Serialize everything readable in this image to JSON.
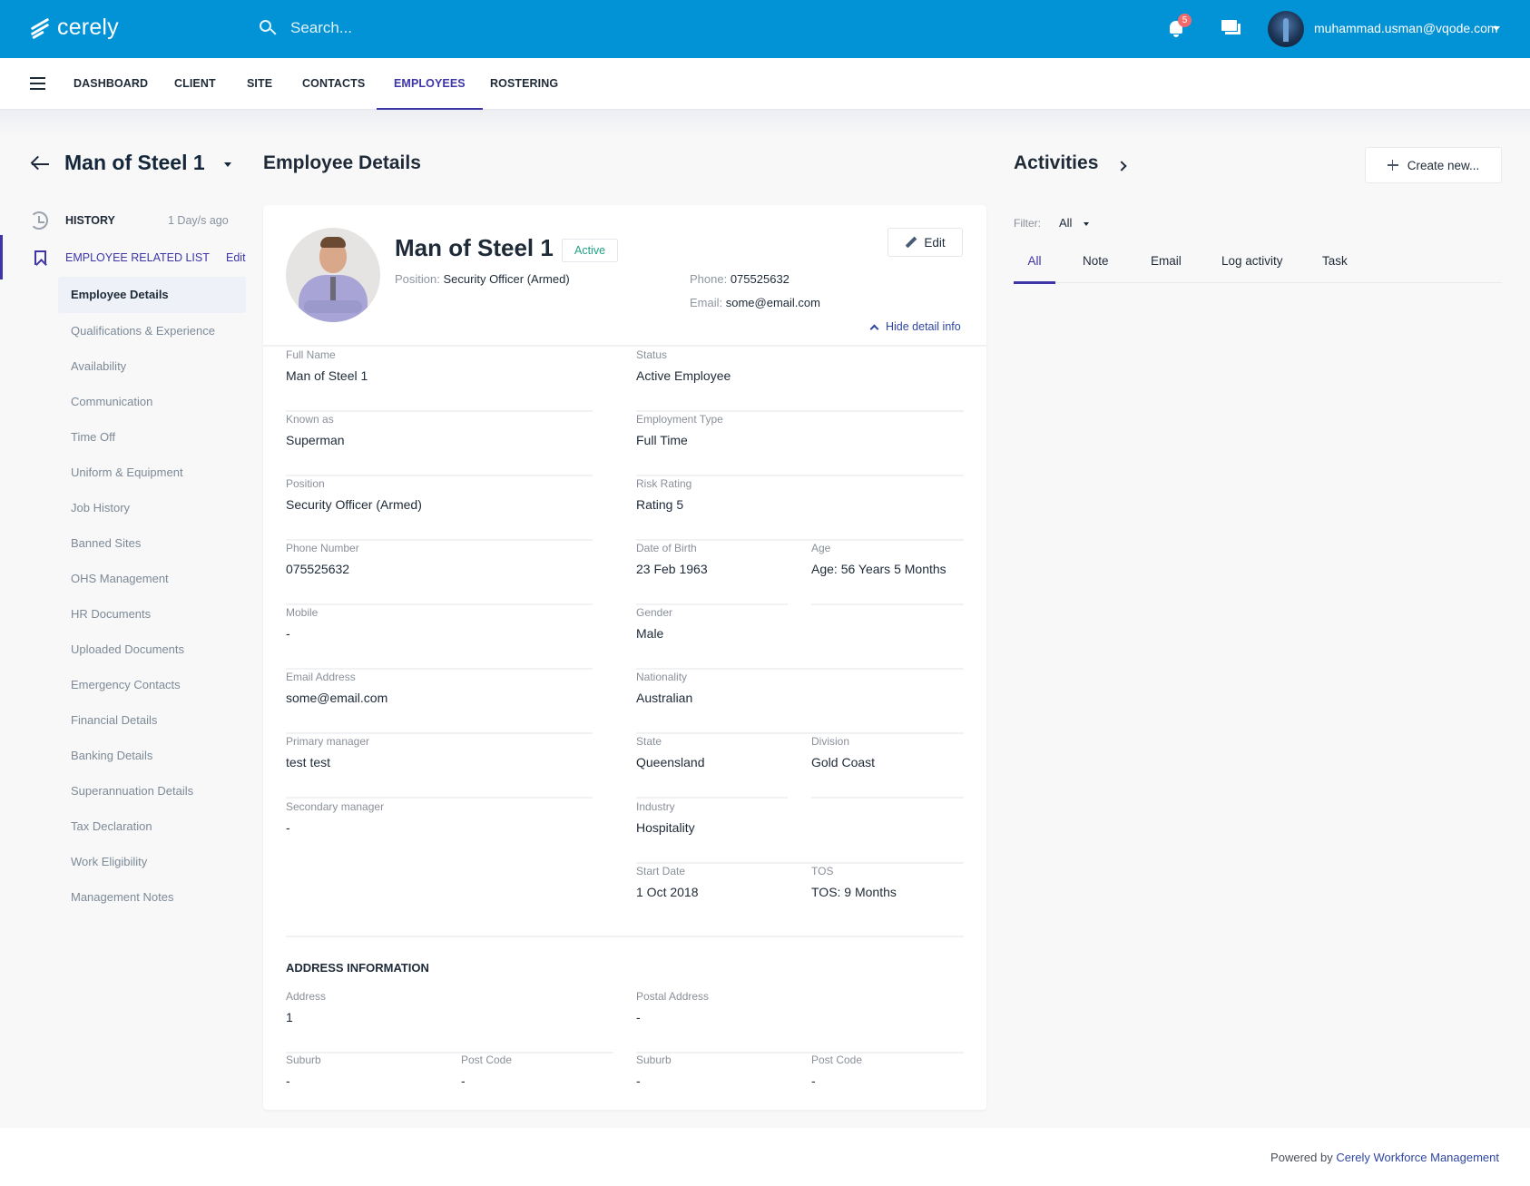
{
  "topbar": {
    "brand": "cerely",
    "search_placeholder": "Search...",
    "notification_count": "5",
    "user_email": "muhammad.usman@vqode.com"
  },
  "nav": {
    "items": [
      {
        "label": "DASHBOARD",
        "active": false
      },
      {
        "label": "CLIENT",
        "active": false
      },
      {
        "label": "SITE",
        "active": false
      },
      {
        "label": "CONTACTS",
        "active": false
      },
      {
        "label": "EMPLOYEES",
        "active": true
      },
      {
        "label": "ROSTERING",
        "active": false
      }
    ]
  },
  "record": {
    "title": "Man of Steel 1"
  },
  "sidebar": {
    "history_label": "HISTORY",
    "history_time": "1 Day/s ago",
    "related_label": "EMPLOYEE RELATED LIST",
    "related_edit": "Edit",
    "items": [
      {
        "label": "Employee Details",
        "active": true
      },
      {
        "label": "Qualifications & Experience"
      },
      {
        "label": "Availability"
      },
      {
        "label": "Communication"
      },
      {
        "label": "Time Off"
      },
      {
        "label": "Uniform & Equipment"
      },
      {
        "label": "Job History"
      },
      {
        "label": "Banned Sites"
      },
      {
        "label": "OHS Management"
      },
      {
        "label": "HR Documents"
      },
      {
        "label": "Uploaded Documents"
      },
      {
        "label": "Emergency Contacts"
      },
      {
        "label": "Financial Details"
      },
      {
        "label": "Banking Details"
      },
      {
        "label": "Superannuation Details"
      },
      {
        "label": "Tax Declaration"
      },
      {
        "label": "Work Eligibility"
      },
      {
        "label": "Management Notes"
      }
    ]
  },
  "main": {
    "title": "Employee Details",
    "profile": {
      "name": "Man of Steel 1",
      "status": "Active",
      "position_label": "Position:",
      "position": "Security Officer (Armed)",
      "phone_label": "Phone:",
      "phone": "075525632",
      "email_label": "Email:",
      "email": "some@email.com",
      "edit_label": "Edit",
      "hide_label": "Hide detail info"
    },
    "fields": {
      "full_name": {
        "label": "Full Name",
        "value": "Man of Steel 1"
      },
      "status": {
        "label": "Status",
        "value": "Active Employee"
      },
      "known_as": {
        "label": "Known as",
        "value": "Superman"
      },
      "employment_type": {
        "label": "Employment Type",
        "value": "Full Time"
      },
      "position": {
        "label": "Position",
        "value": "Security Officer (Armed)"
      },
      "risk_rating": {
        "label": "Risk Rating",
        "value": "Rating 5"
      },
      "phone_number": {
        "label": "Phone Number",
        "value": "075525632"
      },
      "dob": {
        "label": "Date of Birth",
        "value": "23 Feb 1963"
      },
      "age": {
        "label": "Age",
        "value": "Age: 56 Years 5 Months"
      },
      "mobile": {
        "label": "Mobile",
        "value": "-"
      },
      "gender": {
        "label": "Gender",
        "value": "Male"
      },
      "email_address": {
        "label": "Email Address",
        "value": "some@email.com"
      },
      "nationality": {
        "label": "Nationality",
        "value": "Australian"
      },
      "primary_manager": {
        "label": "Primary manager",
        "value": "test test"
      },
      "state": {
        "label": "State",
        "value": "Queensland"
      },
      "division": {
        "label": "Division",
        "value": "Gold Coast"
      },
      "secondary_manager": {
        "label": "Secondary manager",
        "value": "-"
      },
      "industry": {
        "label": "Industry",
        "value": "Hospitality"
      },
      "start_date": {
        "label": "Start Date",
        "value": "1 Oct 2018"
      },
      "tos": {
        "label": "TOS",
        "value": "TOS: 9 Months"
      }
    },
    "address": {
      "title": "ADDRESS INFORMATION",
      "address": {
        "label": "Address",
        "value": "1"
      },
      "postal_address": {
        "label": "Postal Address",
        "value": "-"
      },
      "suburb": {
        "label": "Suburb",
        "value": "-"
      },
      "post_code": {
        "label": "Post Code",
        "value": "-"
      },
      "postal_suburb": {
        "label": "Suburb",
        "value": "-"
      },
      "postal_post_code": {
        "label": "Post Code",
        "value": "-"
      }
    }
  },
  "activities": {
    "title": "Activities",
    "create_label": "Create new...",
    "filter_label": "Filter:",
    "filter_value": "All",
    "tabs": [
      {
        "label": "All",
        "active": true
      },
      {
        "label": "Note"
      },
      {
        "label": "Email"
      },
      {
        "label": "Log activity"
      },
      {
        "label": "Task"
      }
    ]
  },
  "footer": {
    "prefix": "Powered by",
    "link": "Cerely Workforce Management"
  }
}
